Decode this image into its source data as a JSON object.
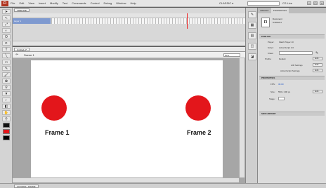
{
  "app": {
    "logo": "Fl"
  },
  "menubar": {
    "items": [
      "File",
      "Edit",
      "View",
      "Insert",
      "Modify",
      "Text",
      "Commands",
      "Control",
      "Debug",
      "Window",
      "Help"
    ],
    "workspace": "CLASSIC ▾",
    "cslive": "CS Live"
  },
  "timeline": {
    "tab": "TIMELINE",
    "ticks": [
      "5",
      "10",
      "15",
      "20",
      "25",
      "30",
      "35",
      "40",
      "45",
      "50",
      "55",
      "60",
      "65",
      "70",
      "75"
    ],
    "layer_name": "Layer 1"
  },
  "stage": {
    "tab": "Untitled-4*",
    "scene": "Scene 1",
    "zoom": "50%",
    "frame1_label": "Frame 1",
    "frame2_label": "Frame 2",
    "circle_color": "#e3161b"
  },
  "status": {
    "tab": "ACTIONS - FRAME"
  },
  "properties": {
    "tabs": [
      "LIBRARY",
      "PROPERTIES"
    ],
    "doc_icon": "Fl",
    "doc_type": "Document",
    "doc_name": "Untitled-4",
    "publish_header": "PUBLISH",
    "player_label": "Player:",
    "player_value": "Flash Player 10",
    "script_label": "Script:",
    "script_value": "ActionScript 3.0",
    "class_label": "Class:",
    "profile_label": "Profile:",
    "profile_value": "Default",
    "air_label": "AIR Settings",
    "as_label": "ActionScript Settings",
    "edit_label": "Edit...",
    "props_header": "PROPERTIES",
    "fps_label": "FPS:",
    "fps_value": "30.00",
    "size_label": "Size:",
    "size_value": "550 x 400 px",
    "stage_label": "Stage:",
    "swf_header": "SWF HISTORY"
  }
}
